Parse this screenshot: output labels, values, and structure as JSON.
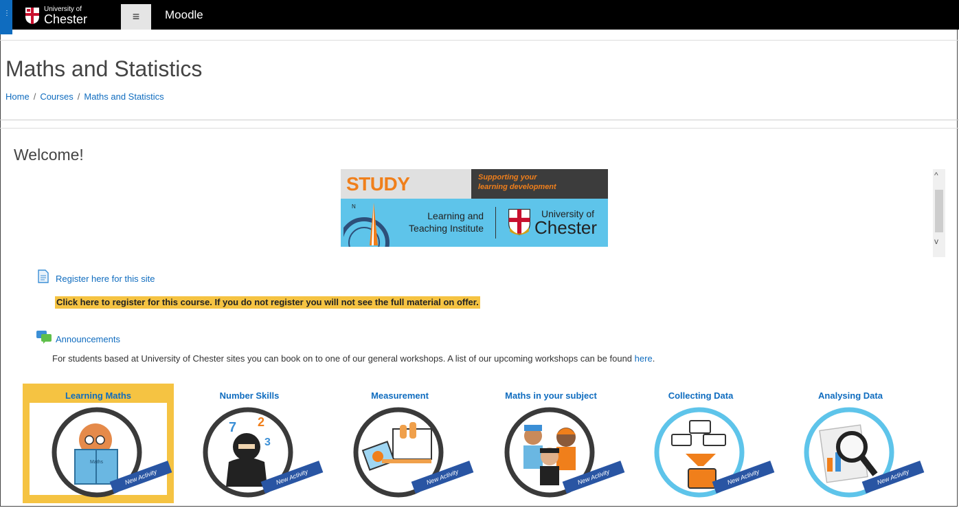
{
  "topbar": {
    "logo_line1": "University of",
    "logo_line2": "Chester",
    "menu_icon": "≡",
    "site_name": "Moodle"
  },
  "header": {
    "title": "Maths and Statistics",
    "breadcrumb": [
      "Home",
      "Courses",
      "Maths and Statistics"
    ]
  },
  "main": {
    "welcome": "Welcome!",
    "banner": {
      "study_skills": "STUDY SKILLS",
      "tagline_line1": "Supporting your",
      "tagline_line2": "learning development",
      "institute_line1": "Learning and",
      "institute_line2": "Teaching Institute",
      "uni_line1": "University of",
      "uni_line2": "Chester"
    },
    "register": {
      "link": "Register here for this site",
      "notice": "Click here to register for this course. If you do not register you will not see the full material on offer."
    },
    "announcements": {
      "link": "Announcements",
      "text": "For students based at University of Chester sites you can book on to one of our general workshops. A list of our upcoming workshops can be found",
      "here_link": "here",
      "end": "."
    },
    "activities": [
      {
        "label": "Learning Maths",
        "ribbon": "New Activity",
        "icon": "reading-child-icon"
      },
      {
        "label": "Number Skills",
        "ribbon": "New Activity",
        "icon": "ninja-numbers-icon"
      },
      {
        "label": "Measurement",
        "ribbon": "New Activity",
        "icon": "measurement-tools-icon"
      },
      {
        "label": "Maths in your subject",
        "ribbon": "New Activity",
        "icon": "professions-icon"
      },
      {
        "label": "Collecting Data",
        "ribbon": "New Activity",
        "icon": "data-funnel-icon"
      },
      {
        "label": "Analysing Data",
        "ribbon": "New Activity",
        "icon": "magnifier-chart-icon"
      }
    ]
  },
  "colors": {
    "link": "#0f6cbf",
    "highlight": "#f5c342",
    "topbar": "#000000",
    "banner_blue": "#5ec4ea",
    "banner_orange": "#f07f1b"
  }
}
